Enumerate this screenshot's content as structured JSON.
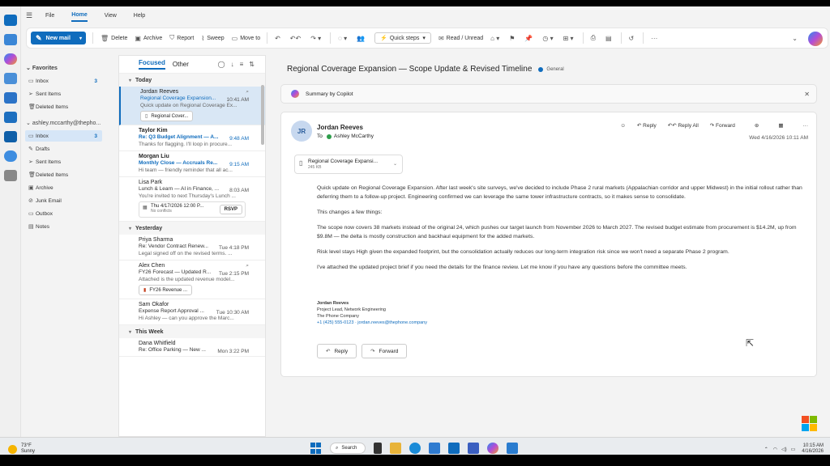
{
  "menu": {
    "items": [
      "File",
      "Home",
      "View",
      "Help"
    ],
    "active": "Home"
  },
  "ribbon": {
    "new_mail": "New mail",
    "delete": "Delete",
    "archive": "Archive",
    "report": "Report",
    "sweep": "Sweep",
    "move_to": "Move to",
    "quick_steps": "Quick steps",
    "read_unread": "Read / Unread"
  },
  "folders": {
    "favorites_label": "Favorites",
    "favorites": [
      {
        "label": "Inbox",
        "count": "3"
      },
      {
        "label": "Sent Items",
        "count": ""
      },
      {
        "label": "Deleted Items",
        "count": ""
      }
    ],
    "account": "ashley.mccarthy@thepho...",
    "account_folders": [
      {
        "label": "Inbox",
        "count": "3"
      },
      {
        "label": "Drafts",
        "count": ""
      },
      {
        "label": "Sent Items",
        "count": ""
      },
      {
        "label": "Deleted Items",
        "count": ""
      },
      {
        "label": "Archive",
        "count": ""
      },
      {
        "label": "Junk Email",
        "count": ""
      },
      {
        "label": "Outbox",
        "count": ""
      },
      {
        "label": "Notes",
        "count": ""
      }
    ]
  },
  "list": {
    "tabs": [
      "Focused",
      "Other"
    ],
    "groups": {
      "today": "Today",
      "yesterday": "Yesterday",
      "this_week": "This Week"
    },
    "messages": [
      {
        "from": "Jordan Reeves",
        "subject": "Regional Coverage Expansion...",
        "time": "10:41 AM",
        "preview": "Quick update on Regional Coverage Ex...",
        "attachment": "Regional Cover..."
      },
      {
        "from": "Taylor Kim",
        "subject": "Re: Q3 Budget Alignment — A...",
        "time": "9:48 AM",
        "preview": "Thanks for flagging. I'll loop in procure..."
      },
      {
        "from": "Morgan Liu",
        "subject": "Monthly Close — Accruals Re...",
        "time": "9:15 AM",
        "preview": "Hi team — friendly reminder that all ac..."
      },
      {
        "from": "Lisa Park",
        "subject": "Lunch & Learn — AI in Finance, ...",
        "time": "8:03 AM",
        "preview": "You're invited to next Thursday's Lunch ...",
        "event_time": "Thu 4/17/2026 12:00 P...",
        "event_conflict": "No conflicts",
        "rsvp": "RSVP"
      },
      {
        "from": "Priya Sharma",
        "subject": "Re: Vendor Contract Renew...",
        "time": "Tue 4:18 PM",
        "preview": "Legal signed off on the revised terms. ..."
      },
      {
        "from": "Alex Chen",
        "subject": "FY26 Forecast — Updated R...",
        "time": "Tue 2:15 PM",
        "preview": "Attached is the updated revenue model...",
        "attachment": "FY26 Revenue ..."
      },
      {
        "from": "Sam Okafor",
        "subject": "Expense Report Approval ...",
        "time": "Tue 10:30 AM",
        "preview": "Hi Ashley — can you approve the Marc..."
      },
      {
        "from": "Dana Whitfield",
        "subject": "Re: Office Parking — New ...",
        "time": "Mon 3:22 PM",
        "preview": ""
      }
    ]
  },
  "reading": {
    "subject": "Regional Coverage Expansion — Scope Update & Revised Timeline",
    "tag": "General",
    "summary_label": "Summary by Copilot",
    "avatar": "JR",
    "sender": "Jordan Reeves",
    "to_label": "To",
    "recipient": "Ashley McCarthy",
    "actions": {
      "reply": "Reply",
      "reply_all": "Reply All",
      "forward": "Forward"
    },
    "datetime": "Wed 4/16/2026 10:11 AM",
    "attachment": {
      "name": "Regional Coverage Expansi...",
      "size": "245 KB"
    },
    "paragraphs": [
      "Quick update on Regional Coverage Expansion. After last week's site surveys, we've decided to include Phase 2 rural markets (Appalachian corridor and upper Midwest) in the initial rollout rather than deferring them to a follow-up project. Engineering confirmed we can leverage the same tower infrastructure contracts, so it makes sense to consolidate.",
      "This changes a few things:",
      "The scope now covers 38 markets instead of the original 24, which pushes our target launch from November 2026 to March 2027. The revised budget estimate from procurement is $14.2M, up from $9.8M — the delta is mostly construction and backhaul equipment for the added markets.",
      "Risk level stays High given the expanded footprint, but the consolidation actually reduces our long-term integration risk since we won't need a separate Phase 2 program.",
      "I've attached the updated project brief if you need the details for the finance review. Let me know if you have any questions before the committee meets."
    ],
    "signature": {
      "name": "Jordan Reeves",
      "title": "Project Lead, Network Engineering",
      "company": "The Phone Company",
      "contact": "+1 (425) 555-0123 · jordan.reeves@thephone.company"
    },
    "bottom_reply": "Reply",
    "bottom_forward": "Forward"
  },
  "taskbar": {
    "temp": "73°F",
    "weather": "Sunny",
    "search": "Search",
    "time": "10:15 AM",
    "date": "4/16/2026"
  }
}
